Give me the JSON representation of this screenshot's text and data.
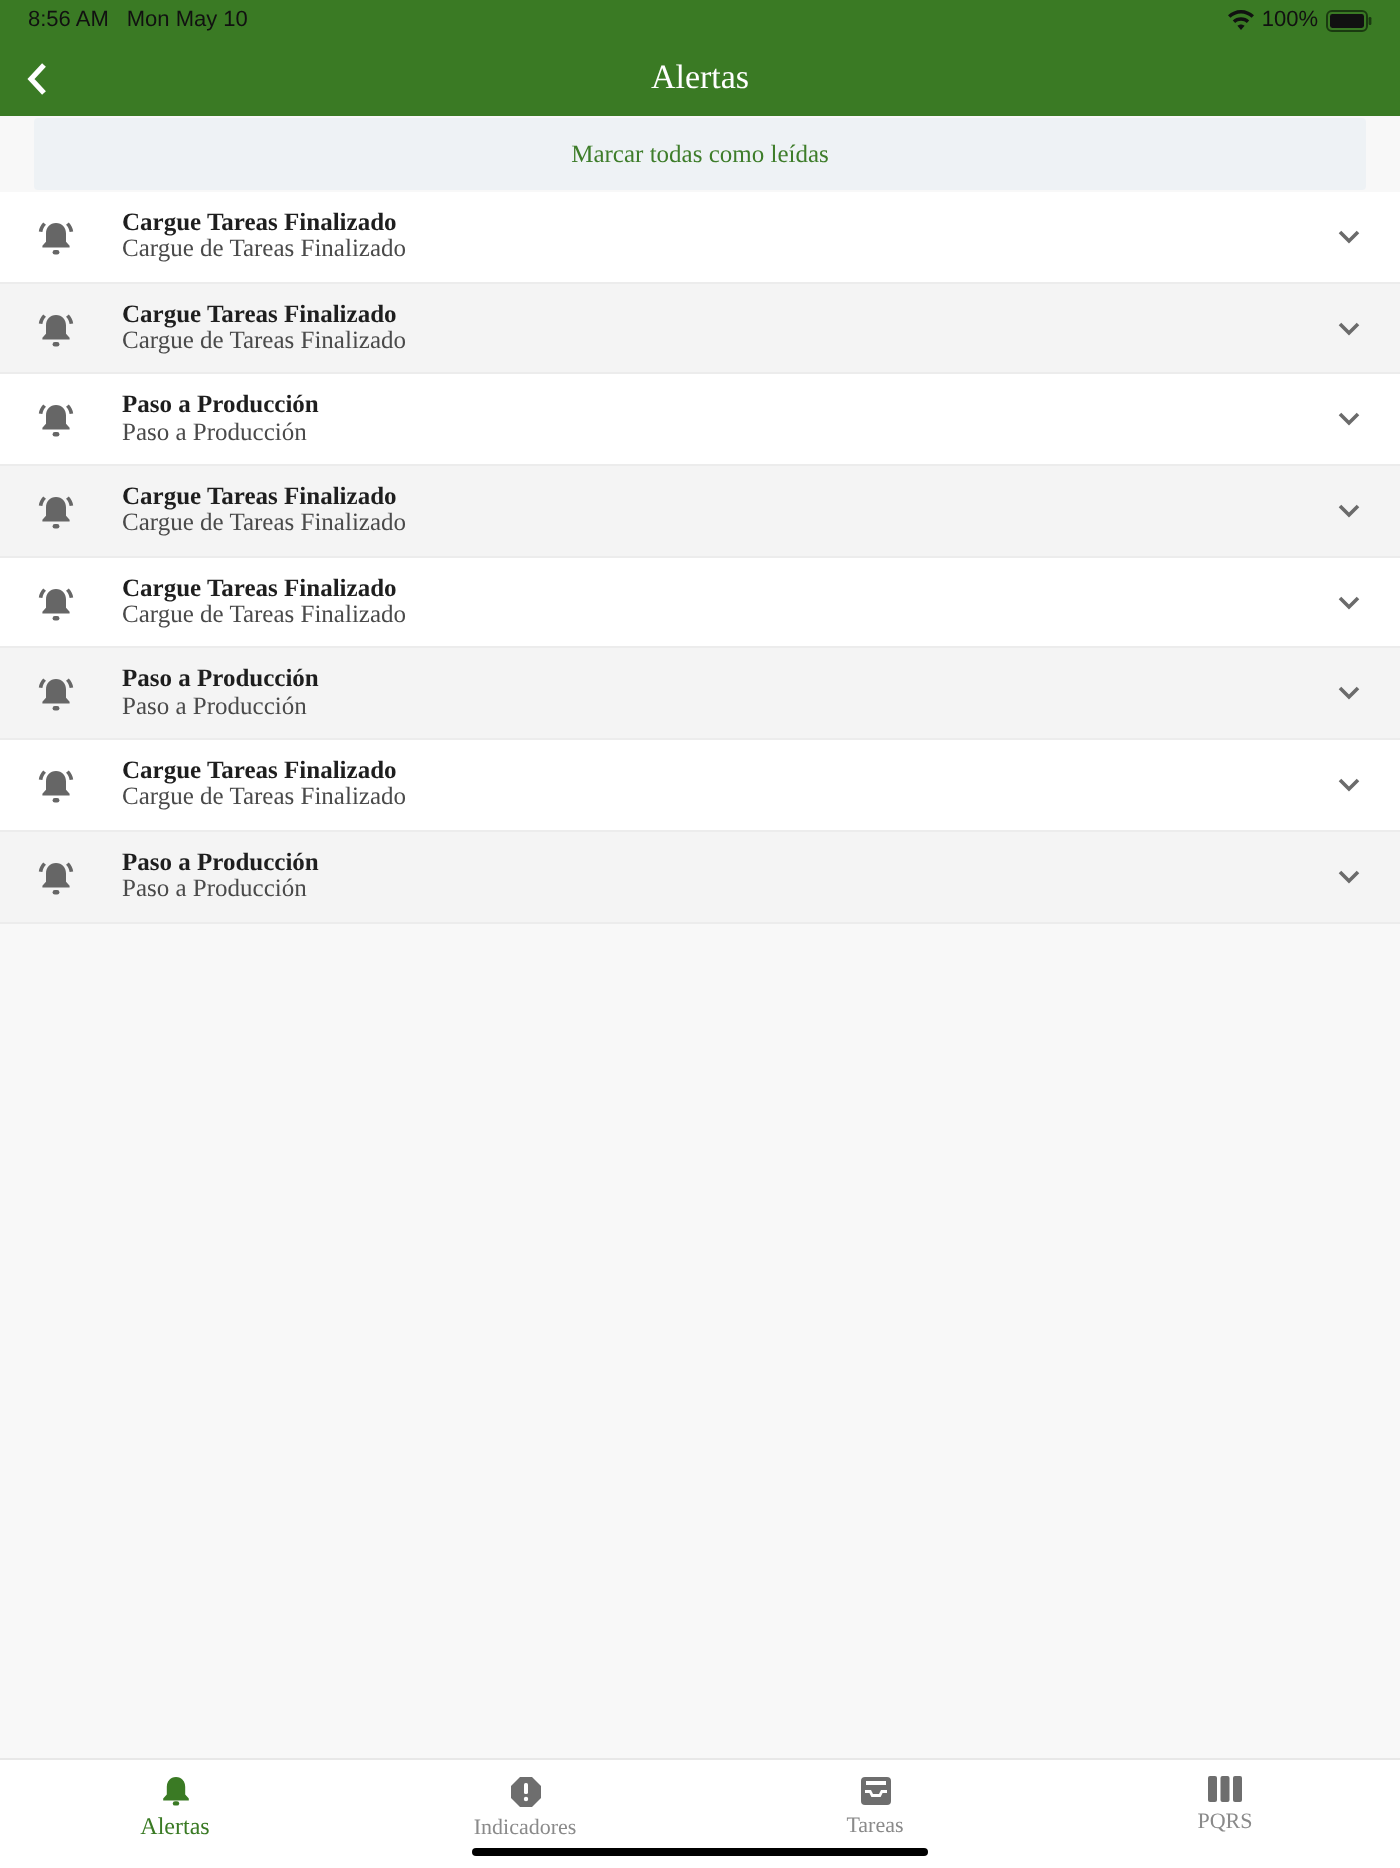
{
  "status_bar": {
    "time": "8:56 AM",
    "date": "Mon May 10",
    "battery": "100%"
  },
  "nav_bar": {
    "title": "Alertas"
  },
  "mark_all_button": {
    "label": "Marcar todas como leídas"
  },
  "alerts": [
    {
      "title": "Cargue Tareas Finalizado",
      "subtitle": "Cargue de Tareas Finalizado",
      "expanded": false
    },
    {
      "title": "Cargue Tareas Finalizado",
      "subtitle": "Cargue de Tareas Finalizado",
      "expanded": false
    },
    {
      "title": "Paso a Producción",
      "subtitle": "Paso a Producción",
      "expanded": false
    },
    {
      "title": "Cargue Tareas Finalizado",
      "subtitle": "Cargue de Tareas Finalizado",
      "expanded": false
    },
    {
      "title": "Cargue Tareas Finalizado",
      "subtitle": "Cargue de Tareas Finalizado",
      "expanded": false
    },
    {
      "title": "Paso a Producción",
      "subtitle": "Paso a Producción",
      "expanded": false
    },
    {
      "title": "Cargue Tareas Finalizado",
      "subtitle": "Cargue de Tareas Finalizado",
      "expanded": false
    },
    {
      "title": "Paso a Producción",
      "subtitle": "Paso a Producción",
      "expanded": false
    }
  ],
  "tab_bar": [
    {
      "label": "Alertas",
      "selected": true
    },
    {
      "label": "Indicadores",
      "selected": false
    },
    {
      "label": "Tareas",
      "selected": false
    },
    {
      "label": "PQRS",
      "selected": false
    }
  ]
}
